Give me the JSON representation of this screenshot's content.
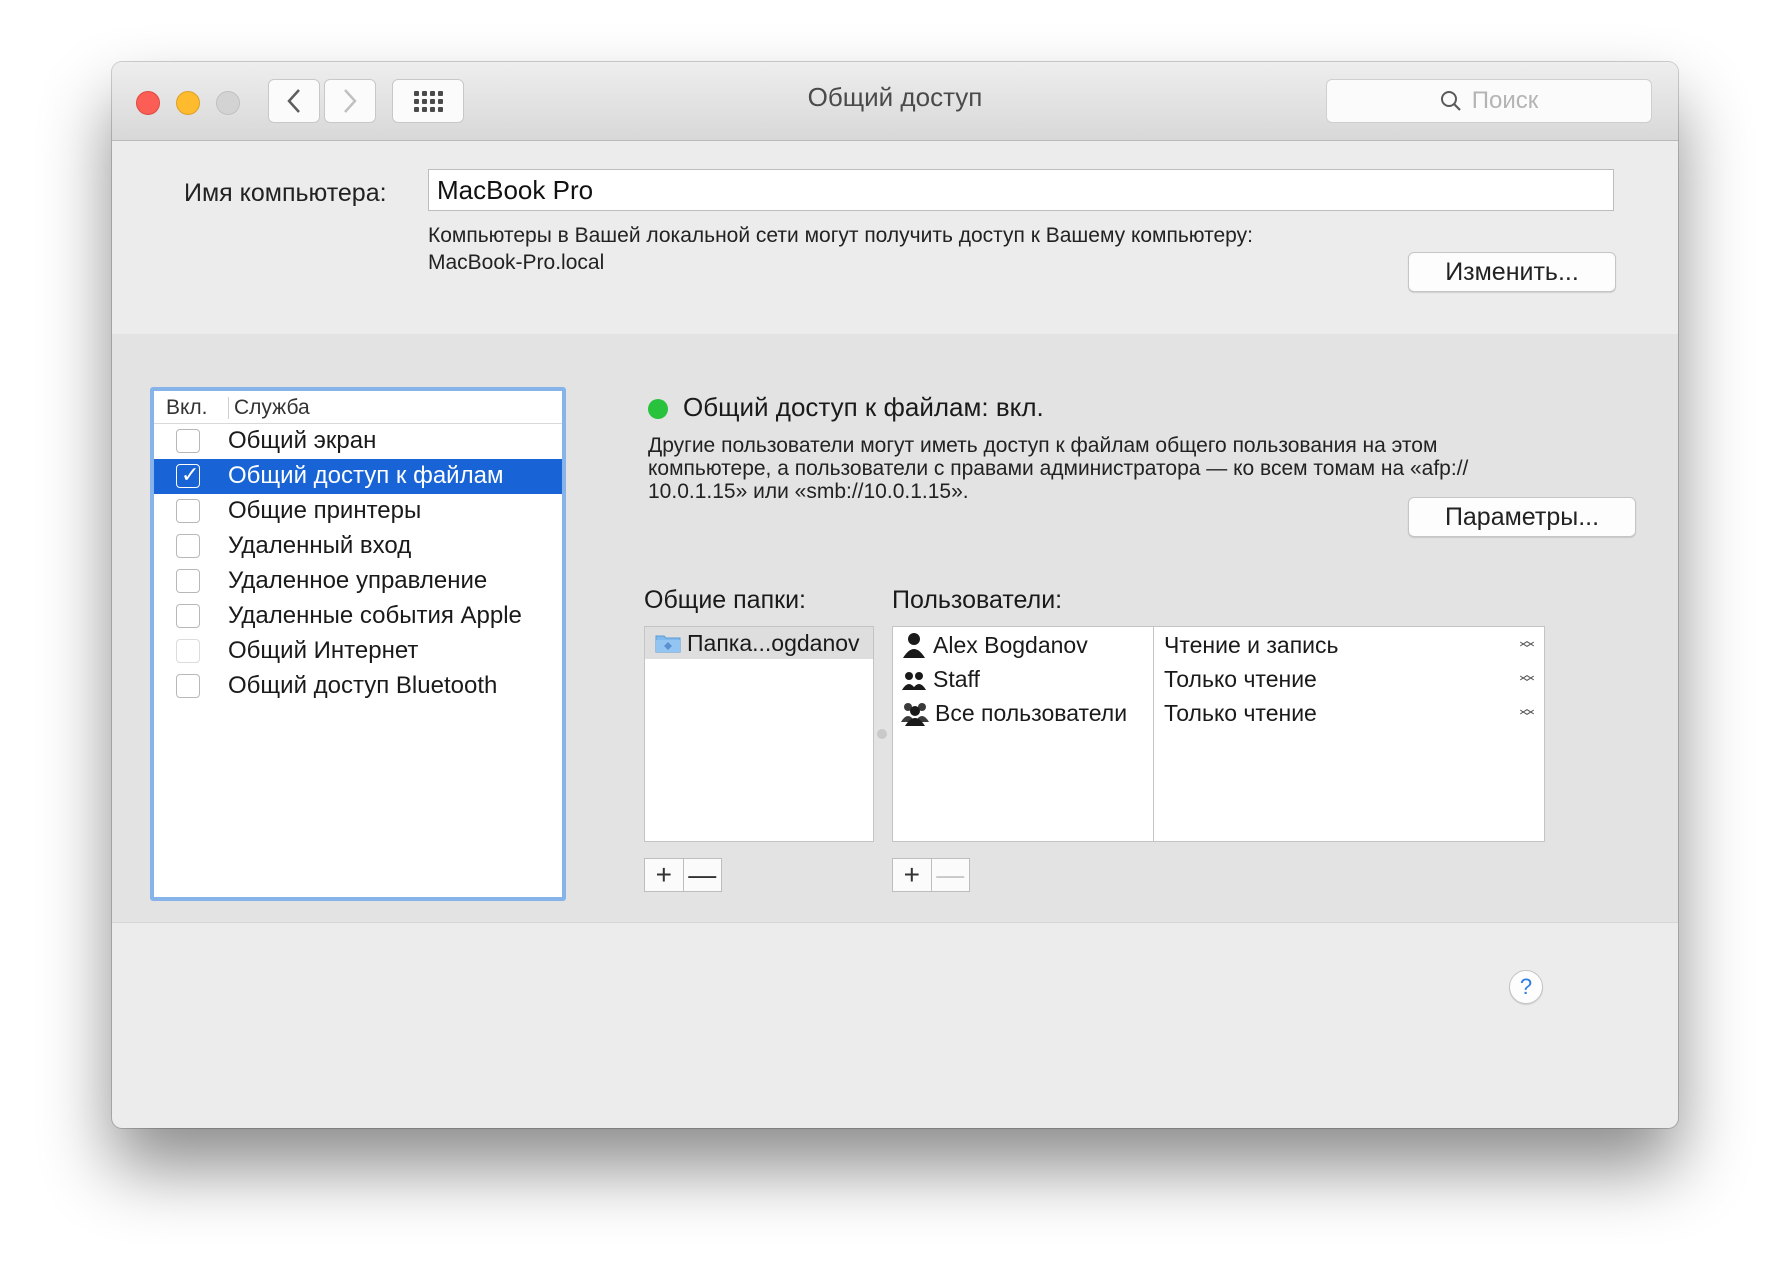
{
  "window": {
    "title": "Общий доступ"
  },
  "toolbar": {
    "search_placeholder": "Поиск"
  },
  "computer_name": {
    "label": "Имя компьютера:",
    "value": "MacBook Pro",
    "description_line1": "Компьютеры в Вашей локальной сети могут получить доступ к Вашему компьютеру:",
    "description_line2": "MacBook-Pro.local",
    "edit_button": "Изменить..."
  },
  "services": {
    "header_on": "Вкл.",
    "header_service": "Служба",
    "items": [
      {
        "label": "Общий экран",
        "checked": false,
        "selected": false
      },
      {
        "label": "Общий доступ к файлам",
        "checked": true,
        "selected": true
      },
      {
        "label": "Общие принтеры",
        "checked": false,
        "selected": false
      },
      {
        "label": "Удаленный вход",
        "checked": false,
        "selected": false
      },
      {
        "label": "Удаленное управление",
        "checked": false,
        "selected": false
      },
      {
        "label": "Удаленные события Apple",
        "checked": false,
        "selected": false
      },
      {
        "label": "Общий Интернет",
        "checked": false,
        "selected": false
      },
      {
        "label": "Общий доступ Bluetooth",
        "checked": false,
        "selected": false
      }
    ]
  },
  "status": {
    "text": "Общий доступ к файлам: вкл.",
    "color": "#28c23d",
    "desc_line1": "Другие пользователи могут иметь доступ к файлам общего пользования на этом",
    "desc_line2": "компьютере, а пользователи с правами администратора — ко всем томам на «afp://",
    "desc_line3": "10.0.1.15» или «smb://10.0.1.15».",
    "params_button": "Параметры..."
  },
  "shared_folders": {
    "label": "Общие папки:",
    "items": [
      {
        "name": "Папка...ogdanov"
      }
    ]
  },
  "users": {
    "label": "Пользователи:",
    "items": [
      {
        "name": "Alex Bogdanov",
        "permission": "Чтение и запись",
        "icon": "user-icon"
      },
      {
        "name": "Staff",
        "permission": "Только чтение",
        "icon": "group-icon"
      },
      {
        "name": "Все пользователи",
        "permission": "Только чтение",
        "icon": "everyone-icon"
      }
    ]
  },
  "controls": {
    "plus": "+",
    "minus": "—",
    "help": "?"
  }
}
